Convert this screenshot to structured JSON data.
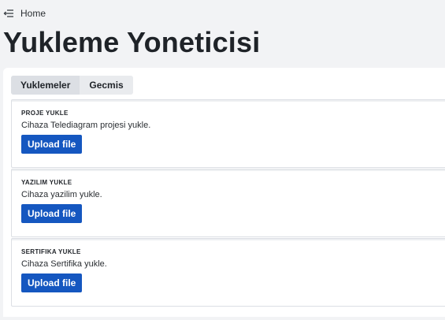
{
  "nav": {
    "home_label": "Home"
  },
  "page": {
    "title": "Yukleme Yoneticisi"
  },
  "tabs": [
    {
      "label": "Yuklemeler",
      "active": true
    },
    {
      "label": "Gecmis",
      "active": false
    }
  ],
  "cards": [
    {
      "title": "PROJE YUKLE",
      "description": "Cihaza Telediagram projesi yukle.",
      "button_label": "Upload file"
    },
    {
      "title": "YAZILIM YUKLE",
      "description": "Cihaza yazilim yukle.",
      "button_label": "Upload file"
    },
    {
      "title": "SERTIFIKA YUKLE",
      "description": "Cihaza Sertifika yukle.",
      "button_label": "Upload file"
    }
  ],
  "colors": {
    "accent": "#1557c0",
    "background": "#f2f3f5",
    "panel": "#ffffff"
  }
}
